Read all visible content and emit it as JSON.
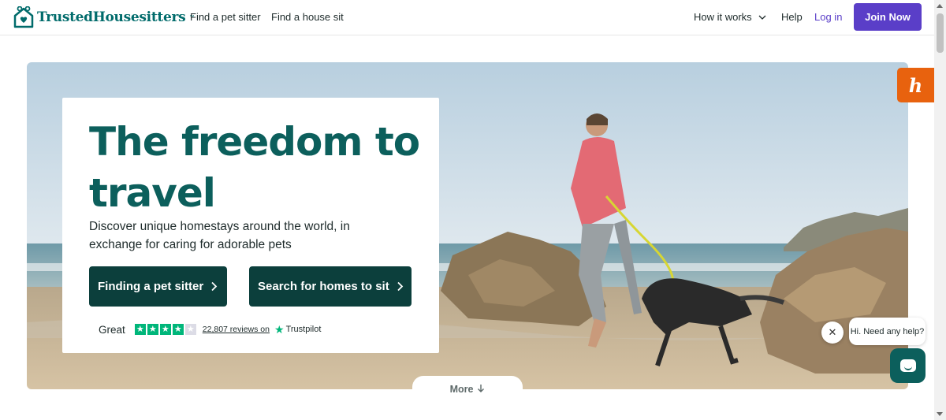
{
  "header": {
    "logo_text": "TrustedHousesitters",
    "logo_tm": "™",
    "nav": {
      "find_sitter": "Find a pet sitter",
      "find_sit": "Find a house sit",
      "how_it_works": "How it works",
      "help": "Help",
      "login": "Log in"
    },
    "join_label": "Join Now"
  },
  "hero": {
    "title": "The freedom to travel",
    "subtitle": "Discover unique homestays around the world, in exchange for caring for adorable pets",
    "cta_primary": "Finding a pet sitter",
    "cta_secondary": "Search for homes to sit",
    "rating": {
      "label": "Great",
      "stars_filled": 4,
      "stars_total": 5,
      "reviews_text": "22,807 reviews on",
      "provider": "Trustpilot"
    },
    "more_label": "More"
  },
  "widgets": {
    "honey_letter": "h",
    "chat_prompt": "Hi. Need any help?"
  },
  "colors": {
    "brand_teal": "#0c5f5c",
    "cta_dark": "#0c3f3c",
    "join_purple": "#5a3ec8",
    "trustpilot_green": "#00b67a",
    "honey_orange": "#e8620e"
  },
  "icons": {
    "logo": "house-heart-icon",
    "nav_chevron": "chevron-down-icon",
    "cta_chevron": "chevron-right-icon",
    "more_arrow": "arrow-down-icon",
    "chat_close": "close-icon",
    "chat_open": "chat-icon",
    "trustpilot": "star-icon"
  }
}
